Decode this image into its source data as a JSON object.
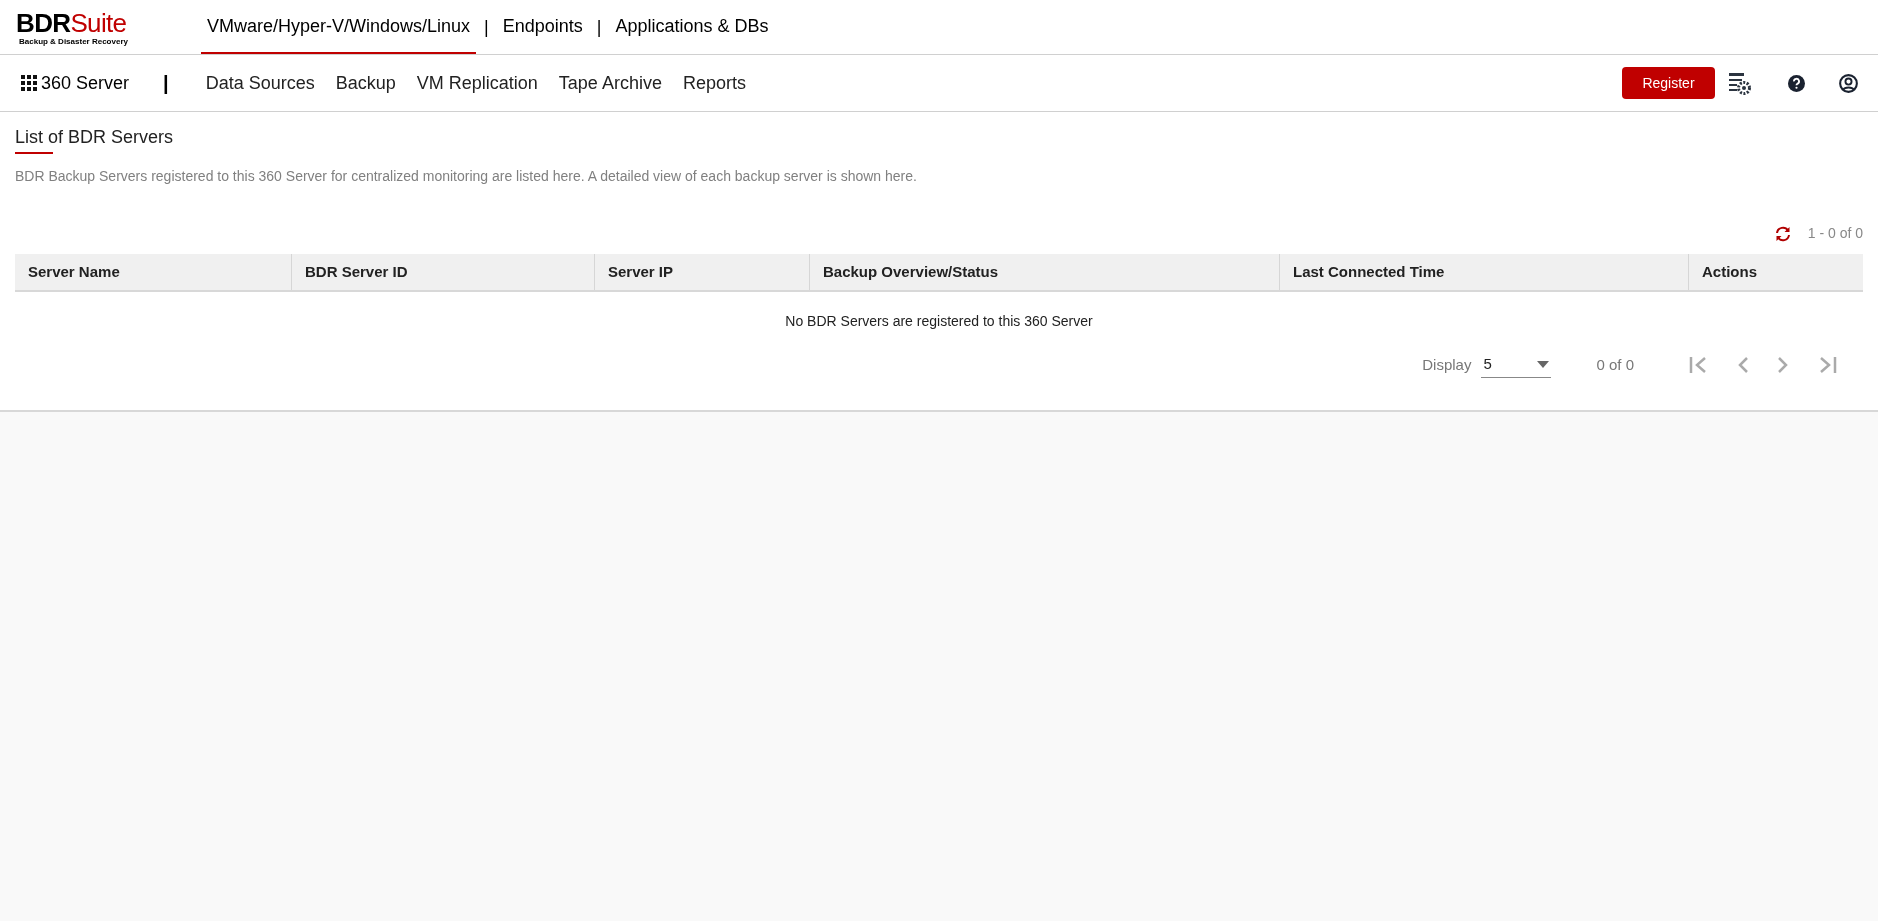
{
  "logo": {
    "main": "BDR",
    "accent": "Suite",
    "tagline": "Backup & Disaster Recovery"
  },
  "top_tabs": [
    {
      "label": "VMware/Hyper-V/Windows/Linux",
      "selected": true
    },
    {
      "label": "Endpoints",
      "selected": false
    },
    {
      "label": "Applications & DBs",
      "selected": false
    }
  ],
  "tab_separator": "|",
  "nav": {
    "home": "360 Server",
    "separator": "|",
    "items": [
      "Data Sources",
      "Backup",
      "VM Replication",
      "Tape Archive",
      "Reports"
    ],
    "register": "Register"
  },
  "page": {
    "title": "List of BDR Servers",
    "description": "BDR Backup Servers registered to this 360 Server for centralized monitoring are listed here. A detailed view of each backup server is shown here.",
    "range": "1 - 0 of 0"
  },
  "table": {
    "columns": [
      "Server Name",
      "BDR Server ID",
      "Server IP",
      "Backup Overview/Status",
      "Last Connected Time",
      "Actions"
    ],
    "empty_message": "No BDR Servers are registered to this 360 Server"
  },
  "pagination": {
    "display_label": "Display",
    "page_size": "5",
    "count": "0 of 0"
  }
}
